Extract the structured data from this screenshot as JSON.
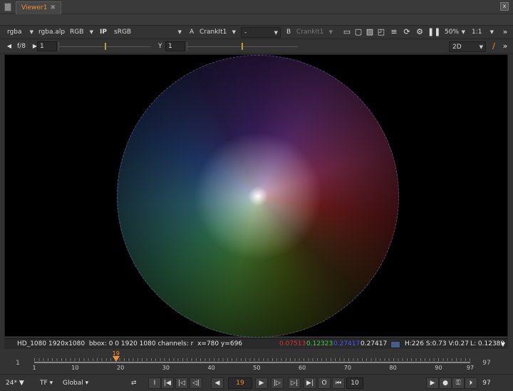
{
  "window": {
    "tab_title": "Viewer1",
    "tab_close": "✖",
    "close": "x"
  },
  "toolbar": {
    "channels": "rgba",
    "alpha": "rgba.alp",
    "display": "RGB",
    "ip": "IP",
    "lut": "sRGB",
    "input_a_letter": "A",
    "input_a": "CrankIt1",
    "compare_mode": "-",
    "input_b_letter": "B",
    "input_b": "CrankIt1",
    "zoom": "50%",
    "proxy": "1:1",
    "menu": "»"
  },
  "exposure": {
    "fstop": "f/8",
    "gain_value": "1",
    "gamma_label": "Y",
    "gamma_value": "1",
    "view_mode": "2D"
  },
  "info": {
    "format": "HD_1080 1920x1080",
    "bbox": "bbox: 0 0 1920 1080",
    "channels": "channels: r",
    "cursor": "x=780 y=696",
    "r": "0.07513",
    "g": "0.12323",
    "b": "0.27417",
    "a": "0.27417",
    "hsv": "H:226 S:0.73 V:0.27",
    "luma": "L: 0.12389",
    "r_color": "#e03030",
    "g_color": "#40d040",
    "b_color": "#5050ff"
  },
  "timeline": {
    "start": "1",
    "end": "97",
    "current": "19",
    "labels": [
      "1",
      "10",
      "20",
      "30",
      "40",
      "50",
      "60",
      "70",
      "80",
      "90",
      "97"
    ]
  },
  "playback": {
    "fps": "24*",
    "time_format": "TF",
    "range": "Global",
    "in_point": "I",
    "out_point": "O",
    "frame": "19",
    "increment": "10",
    "end_frame": "97"
  }
}
